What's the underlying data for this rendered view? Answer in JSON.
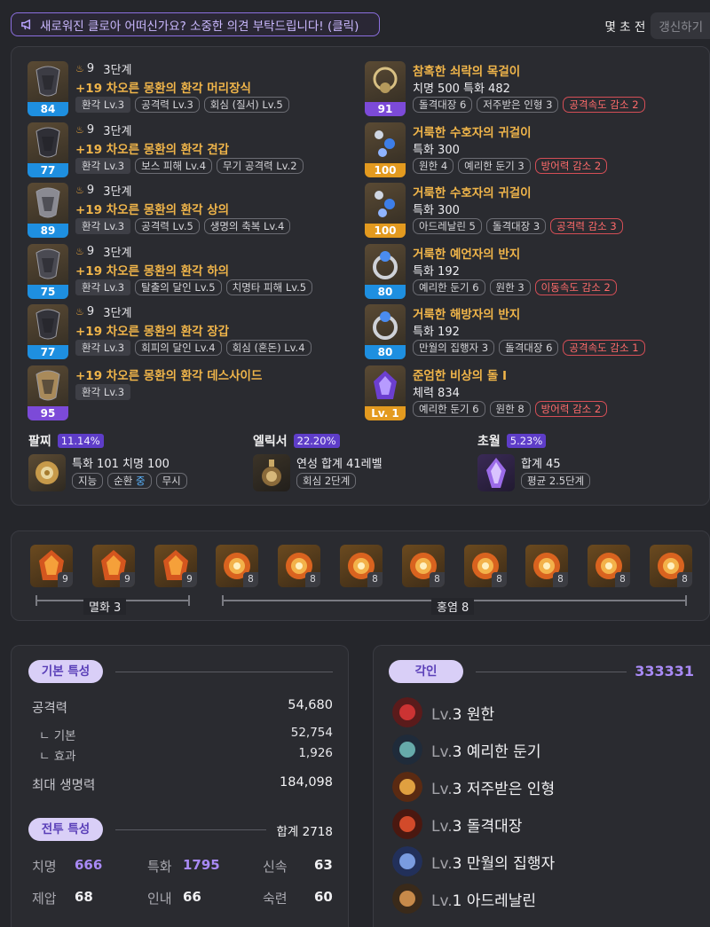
{
  "notice": {
    "icon": "megaphone-icon",
    "text": "새로워진 클로아 어떠신가요? 소중한 의견 부탁드립니다! (클릭)"
  },
  "update": {
    "ago": "몇 초 전",
    "button": "갱신하기"
  },
  "armor": [
    {
      "quality": "84",
      "quality_color": "blue",
      "level": "9",
      "stage": "3단계",
      "name": "+19 차오른 몽환의 환각 머리장식",
      "tags": [
        "환각 Lv.3",
        "공격력 Lv.3",
        "회심 (질서) Lv.5"
      ]
    },
    {
      "quality": "77",
      "quality_color": "blue",
      "level": "9",
      "stage": "3단계",
      "name": "+19 차오른 몽환의 환각 견갑",
      "tags": [
        "환각 Lv.3",
        "보스 피해 Lv.4",
        "무기 공격력 Lv.2"
      ]
    },
    {
      "quality": "89",
      "quality_color": "blue",
      "level": "9",
      "stage": "3단계",
      "name": "+19 차오른 몽환의 환각 상의",
      "tags": [
        "환각 Lv.3",
        "공격력 Lv.5",
        "생명의 축복 Lv.4"
      ]
    },
    {
      "quality": "75",
      "quality_color": "blue",
      "level": "9",
      "stage": "3단계",
      "name": "+19 차오른 몽환의 환각 하의",
      "tags": [
        "환각 Lv.3",
        "탈출의 달인 Lv.5",
        "치명타 피해 Lv.5"
      ]
    },
    {
      "quality": "77",
      "quality_color": "blue",
      "level": "9",
      "stage": "3단계",
      "name": "+19 차오른 몽환의 환각 장갑",
      "tags": [
        "환각 Lv.3",
        "회피의 달인 Lv.4",
        "회심 (혼돈) Lv.4"
      ]
    },
    {
      "quality": "95",
      "quality_color": "purple",
      "name": "+19 차오른 몽환의 환각 데스사이드",
      "tags": [
        "환각 Lv.3"
      ]
    }
  ],
  "accessories": [
    {
      "quality": "91",
      "quality_color": "purple",
      "name": "참혹한 쇠락의 목걸이",
      "stat": "치명 500  특화 482",
      "tags": [
        "돌격대장 6",
        "저주받은 인형 3"
      ],
      "penalty": "공격속도 감소 2"
    },
    {
      "quality": "100",
      "quality_color": "orange",
      "name": "거룩한 수호자의 귀걸이",
      "stat": "특화 300",
      "tags": [
        "원한 4",
        "예리한 둔기 3"
      ],
      "penalty": "방어력 감소 2"
    },
    {
      "quality": "100",
      "quality_color": "orange",
      "name": "거룩한 수호자의 귀걸이",
      "stat": "특화 300",
      "tags": [
        "아드레날린 5",
        "돌격대장 3"
      ],
      "penalty": "공격력 감소 3"
    },
    {
      "quality": "80",
      "quality_color": "blue",
      "name": "거룩한 예언자의 반지",
      "stat": "특화 192",
      "tags": [
        "예리한 둔기 6",
        "원한 3"
      ],
      "penalty": "이동속도 감소 2"
    },
    {
      "quality": "80",
      "quality_color": "blue",
      "name": "거룩한 해방자의 반지",
      "stat": "특화 192",
      "tags": [
        "만월의 집행자 3",
        "돌격대장 6"
      ],
      "penalty": "공격속도 감소 1"
    },
    {
      "quality": "Lv. 1",
      "quality_color": "orange",
      "name": "준엄한 비상의 돌 I",
      "stat": "체력 834",
      "tags": [
        "예리한 둔기 6",
        "원한 8"
      ],
      "penalty": "방어력 감소 2"
    }
  ],
  "bracelet": {
    "title": "팔찌",
    "pct": "11.14%",
    "stat": "특화 101  치명 100",
    "tags": [
      "지능",
      "순환",
      "중",
      "무시"
    ]
  },
  "elixir": {
    "title": "엘릭서",
    "pct": "22.20%",
    "stat": "연성 합계 41레벨",
    "tag": "회심 2단계"
  },
  "transcend": {
    "title": "초월",
    "pct": "5.23%",
    "stat": "합계 45",
    "tag": "평균 2.5단계"
  },
  "gems": {
    "levels": [
      "9",
      "9",
      "9",
      "8",
      "8",
      "8",
      "8",
      "8",
      "8",
      "8",
      "8"
    ],
    "group1": "멸화 3",
    "group2": "홍염 8"
  },
  "basic": {
    "title": "기본 특성",
    "attack_label": "공격력",
    "attack": "54,680",
    "base_label": "기본",
    "base": "52,754",
    "effect_label": "효과",
    "effect": "1,926",
    "hp_label": "최대 생명력",
    "hp": "184,098"
  },
  "combat": {
    "title": "전투 특성",
    "total": "합계 2718",
    "stats": [
      {
        "k": "치명",
        "v": "666",
        "hl": true
      },
      {
        "k": "특화",
        "v": "1795",
        "hl": true
      },
      {
        "k": "신속",
        "v": "63",
        "hl": false
      },
      {
        "k": "제압",
        "v": "68",
        "hl": false
      },
      {
        "k": "인내",
        "v": "66",
        "hl": false
      },
      {
        "k": "숙련",
        "v": "60",
        "hl": false
      }
    ]
  },
  "engravings": {
    "title": "각인",
    "code": "333331",
    "items": [
      {
        "lv": "Lv.",
        "n": "3",
        "name": "원한"
      },
      {
        "lv": "Lv.",
        "n": "3",
        "name": "예리한 둔기"
      },
      {
        "lv": "Lv.",
        "n": "3",
        "name": "저주받은 인형"
      },
      {
        "lv": "Lv.",
        "n": "3",
        "name": "돌격대장"
      },
      {
        "lv": "Lv.",
        "n": "3",
        "name": "만월의 집행자"
      },
      {
        "lv": "Lv.",
        "n": "1",
        "name": "아드레날린"
      }
    ]
  },
  "colors": {
    "accent": "#7c4ad8",
    "gold": "#f0b54a",
    "penalty": "#ff6b6b",
    "quality_blue": "#1e8fe0",
    "quality_orange": "#e39a1f"
  }
}
